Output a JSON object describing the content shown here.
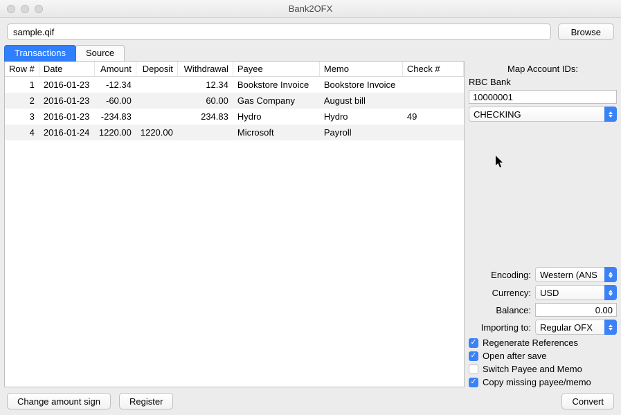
{
  "window": {
    "title": "Bank2OFX"
  },
  "file": {
    "path": "sample.qif",
    "browse_label": "Browse"
  },
  "tabs": {
    "transactions": "Transactions",
    "source": "Source"
  },
  "table": {
    "headers": {
      "row": "Row #",
      "date": "Date",
      "amount": "Amount",
      "deposit": "Deposit",
      "withdrawal": "Withdrawal",
      "payee": "Payee",
      "memo": "Memo",
      "check": "Check #"
    },
    "rows": [
      {
        "row": "1",
        "date": "2016-01-23",
        "amount": "-12.34",
        "deposit": "",
        "withdrawal": "12.34",
        "payee": "Bookstore Invoice",
        "memo": "Bookstore Invoice",
        "check": ""
      },
      {
        "row": "2",
        "date": "2016-01-23",
        "amount": "-60.00",
        "deposit": "",
        "withdrawal": "60.00",
        "payee": "Gas Company",
        "memo": "August bill",
        "check": ""
      },
      {
        "row": "3",
        "date": "2016-01-23",
        "amount": "-234.83",
        "deposit": "",
        "withdrawal": "234.83",
        "payee": "Hydro",
        "memo": "Hydro",
        "check": "49"
      },
      {
        "row": "4",
        "date": "2016-01-24",
        "amount": "1220.00",
        "deposit": "1220.00",
        "withdrawal": "",
        "payee": "Microsoft",
        "memo": "Payroll",
        "check": ""
      }
    ]
  },
  "side": {
    "title": "Map Account IDs:",
    "bank_label": "RBC Bank",
    "account_id": "10000001",
    "account_type": "CHECKING",
    "encoding_label": "Encoding:",
    "encoding_value": "Western (ANS",
    "currency_label": "Currency:",
    "currency_value": "USD",
    "balance_label": "Balance:",
    "balance_value": "0.00",
    "importing_label": "Importing to:",
    "importing_value": "Regular OFX",
    "chk_regen": "Regenerate References",
    "chk_open": "Open after save",
    "chk_switch": "Switch Payee and Memo",
    "chk_copy": "Copy missing payee/memo"
  },
  "bottom": {
    "change_sign": "Change amount sign",
    "register": "Register",
    "convert": "Convert"
  }
}
